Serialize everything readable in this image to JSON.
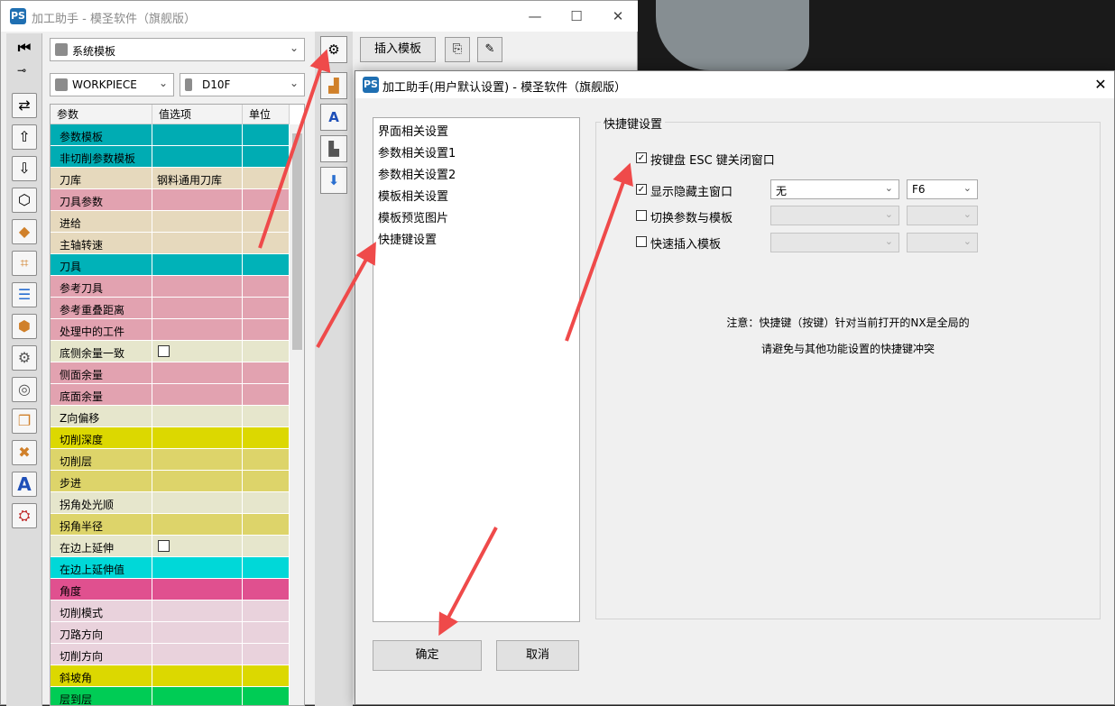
{
  "main_window": {
    "app_logo": "PS",
    "title": "加工助手 - 模圣软件（旗舰版）",
    "template_select": "系统模板",
    "workpiece_select": "WORKPIECE",
    "tool_select": "D10F",
    "insert_template_button": "插入模板",
    "window_controls": {
      "minimize": "—",
      "maximize": "☐",
      "close": "✕"
    }
  },
  "param_table": {
    "headers": [
      "参数",
      "值选项",
      "单位"
    ],
    "rows": [
      {
        "name": "参数模板",
        "value": "",
        "color": "#00acb3"
      },
      {
        "name": "非切削参数模板",
        "value": "",
        "color": "#00acb3"
      },
      {
        "name": "刀库",
        "value": "钢料通用刀库",
        "color": "#e6d9bd"
      },
      {
        "name": "刀具参数",
        "value": "",
        "color": "#e2a2b0"
      },
      {
        "name": "进给",
        "value": "",
        "color": "#e6d9bd"
      },
      {
        "name": "主轴转速",
        "value": "",
        "color": "#e6d9bd"
      },
      {
        "name": "刀具",
        "value": "",
        "color": "#00b2b8"
      },
      {
        "name": "参考刀具",
        "value": "",
        "color": "#e2a2b0"
      },
      {
        "name": "参考重叠距离",
        "value": "",
        "color": "#e2a2b0"
      },
      {
        "name": "处理中的工件",
        "value": "",
        "color": "#e2a2b0"
      },
      {
        "name": "底侧余量一致",
        "value": "",
        "checkbox": true,
        "color": "#e6e6cc"
      },
      {
        "name": "侧面余量",
        "value": "",
        "color": "#e2a2b0"
      },
      {
        "name": "底面余量",
        "value": "",
        "color": "#e2a2b0"
      },
      {
        "name": "Z向偏移",
        "value": "",
        "color": "#e6e6cc"
      },
      {
        "name": "切削深度",
        "value": "",
        "color": "#dcd800"
      },
      {
        "name": "切削层",
        "value": "",
        "color": "#ddd46a"
      },
      {
        "name": "步进",
        "value": "",
        "color": "#ddd46a"
      },
      {
        "name": "拐角处光顺",
        "value": "",
        "color": "#e6e6cc"
      },
      {
        "name": "拐角半径",
        "value": "",
        "color": "#ddd46a"
      },
      {
        "name": "在边上延伸",
        "value": "",
        "checkbox": true,
        "color": "#e6e6cc"
      },
      {
        "name": "在边上延伸值",
        "value": "",
        "color": "#00d8d8"
      },
      {
        "name": "角度",
        "value": "",
        "color": "#e0508f"
      },
      {
        "name": "切削模式",
        "value": "",
        "color": "#e9d2dc"
      },
      {
        "name": "刀路方向",
        "value": "",
        "color": "#e9d2dc"
      },
      {
        "name": "切削方向",
        "value": "",
        "color": "#e9d2dc"
      },
      {
        "name": "斜坡角",
        "value": "",
        "color": "#dcd800"
      },
      {
        "name": "层到层",
        "value": "",
        "color": "#00cc55"
      }
    ]
  },
  "dialog": {
    "title": "加工助手(用户默认设置) - 模圣软件（旗舰版）",
    "close": "✕",
    "nav_items": [
      "界面相关设置",
      "参数相关设置1",
      "参数相关设置2",
      "模板相关设置",
      "模板预览图片",
      "快捷键设置"
    ],
    "group_title": "快捷键设置",
    "options": [
      {
        "label": "按键盘 ESC 键关闭窗口",
        "checked": true
      },
      {
        "label": "显示隐藏主窗口",
        "checked": true,
        "modifier": "无",
        "key": "F6"
      },
      {
        "label": "切换参数与模板",
        "checked": false,
        "modifier": "",
        "key": ""
      },
      {
        "label": "快速插入模板",
        "checked": false,
        "modifier": "",
        "key": ""
      }
    ],
    "note_line1": "注意：快捷键（按键）针对当前打开的NX是全局的",
    "note_line2": "请避免与其他功能设置的快捷键冲突",
    "ok_button": "确定",
    "cancel_button": "取消"
  },
  "colors": {
    "annotation_arrow": "#ef4a4a",
    "checked_mark": "✓"
  }
}
